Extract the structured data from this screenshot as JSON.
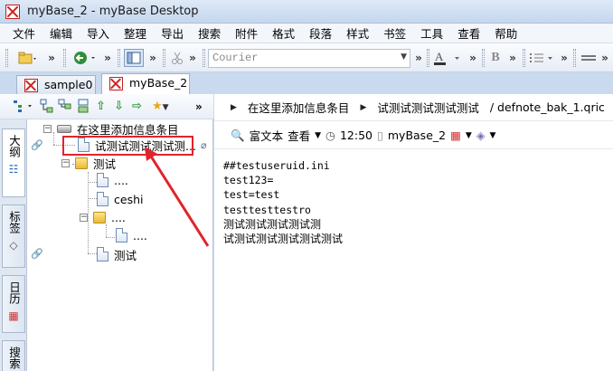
{
  "window": {
    "title": "myBase_2 - myBase Desktop"
  },
  "menu": [
    "文件",
    "编辑",
    "导入",
    "整理",
    "导出",
    "搜索",
    "附件",
    "格式",
    "段落",
    "样式",
    "书签",
    "工具",
    "查看",
    "帮助"
  ],
  "toolbar": {
    "font_name": "Courier",
    "bold": "B",
    "more": "»"
  },
  "tabs": [
    {
      "label": "sample0",
      "active": false
    },
    {
      "label": "myBase_2",
      "active": true
    }
  ],
  "side_tabs": [
    {
      "label": "大纲",
      "icon": "outline-icon"
    },
    {
      "label": "标签",
      "icon": "tag-icon"
    },
    {
      "label": "日历",
      "icon": "calendar-icon"
    },
    {
      "label": "搜索",
      "icon": "search-icon"
    }
  ],
  "tree": {
    "root": "在这里添加信息条目",
    "selected": "试测试测试测试测...",
    "folder": "测试",
    "child1": "....",
    "child2": "ceshi",
    "subfolder": "....",
    "leaf": "....",
    "last": "测试"
  },
  "path": {
    "segments": [
      "在这里添加信息条目",
      "试测试测试测试测试"
    ],
    "file": "/ defnote_bak_1.qric"
  },
  "info": {
    "format": "富文本",
    "view": "查看",
    "time": "12:50",
    "database": "myBase_2"
  },
  "content": {
    "lines": [
      "##testuseruid.ini",
      "test123=",
      "test=test",
      "testtesttestro",
      "测试测试测试测试测",
      "试测试测试测试测试测试"
    ]
  }
}
